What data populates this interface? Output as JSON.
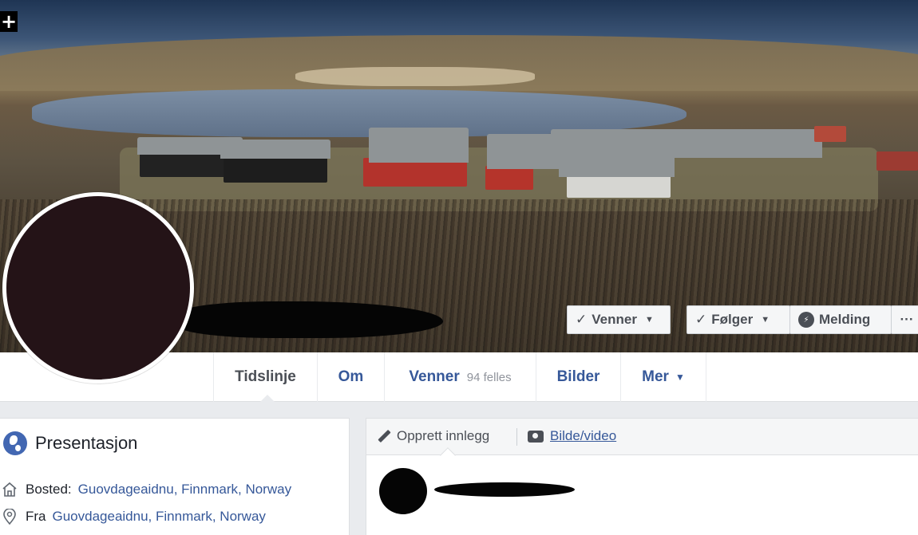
{
  "cover": {
    "add_icon": "+"
  },
  "actions": {
    "friends": {
      "label": "Venner",
      "icon": "check-icon"
    },
    "following": {
      "label": "Følger",
      "icon": "check-icon"
    },
    "message": {
      "label": "Melding",
      "icon": "messenger-icon"
    },
    "more": {
      "label": "···"
    }
  },
  "nav": {
    "tabs": [
      {
        "label": "Tidslinje",
        "active": true
      },
      {
        "label": "Om"
      },
      {
        "label": "Venner",
        "sub": "94 felles"
      },
      {
        "label": "Bilder"
      },
      {
        "label": "Mer",
        "icon": "caret-down-icon"
      }
    ]
  },
  "intro": {
    "title": "Presentasjon",
    "lives_label": "Bosted:",
    "lives_value": "Guovdageaidnu, Finnmark, Norway",
    "from_label": "Fra",
    "from_value": "Guovdageaidnu, Finnmark, Norway"
  },
  "composer": {
    "create_post": "Opprett innlegg",
    "photo_video": "Bilde/video"
  },
  "colors": {
    "link": "#365899",
    "accent": "#4267b2",
    "background": "#e9ebee"
  }
}
